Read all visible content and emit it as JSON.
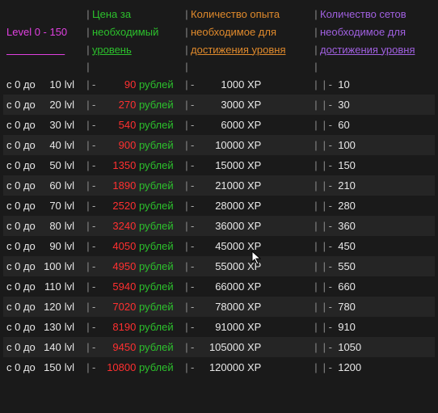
{
  "title": "Level 0 - 150",
  "headers": {
    "price": [
      "Цена за",
      "необходимый",
      "уровень"
    ],
    "xp": [
      "Количество опыта",
      "необходимое для",
      "достижения уровня"
    ],
    "sets": [
      "Количество сетов",
      "необходимое для",
      "достижения уровня"
    ]
  },
  "row_prefix_from": "с 0 до",
  "lvl_suffix": "lvl",
  "currency": "рублей",
  "xp_suffix": "XP",
  "chart_data": {
    "type": "table",
    "columns": [
      "level_to",
      "price_rub",
      "xp",
      "sets"
    ],
    "rows": [
      {
        "level_to": 10,
        "price_rub": 90,
        "xp": 1000,
        "sets": 10
      },
      {
        "level_to": 20,
        "price_rub": 270,
        "xp": 3000,
        "sets": 30
      },
      {
        "level_to": 30,
        "price_rub": 540,
        "xp": 6000,
        "sets": 60
      },
      {
        "level_to": 40,
        "price_rub": 900,
        "xp": 10000,
        "sets": 100
      },
      {
        "level_to": 50,
        "price_rub": 1350,
        "xp": 15000,
        "sets": 150
      },
      {
        "level_to": 60,
        "price_rub": 1890,
        "xp": 21000,
        "sets": 210
      },
      {
        "level_to": 70,
        "price_rub": 2520,
        "xp": 28000,
        "sets": 280
      },
      {
        "level_to": 80,
        "price_rub": 3240,
        "xp": 36000,
        "sets": 360
      },
      {
        "level_to": 90,
        "price_rub": 4050,
        "xp": 45000,
        "sets": 450
      },
      {
        "level_to": 100,
        "price_rub": 4950,
        "xp": 55000,
        "sets": 550
      },
      {
        "level_to": 110,
        "price_rub": 5940,
        "xp": 66000,
        "sets": 660
      },
      {
        "level_to": 120,
        "price_rub": 7020,
        "xp": 78000,
        "sets": 780
      },
      {
        "level_to": 130,
        "price_rub": 8190,
        "xp": 91000,
        "sets": 910
      },
      {
        "level_to": 140,
        "price_rub": 9450,
        "xp": 105000,
        "sets": 1050
      },
      {
        "level_to": 150,
        "price_rub": 10800,
        "xp": 120000,
        "sets": 1200
      }
    ]
  }
}
